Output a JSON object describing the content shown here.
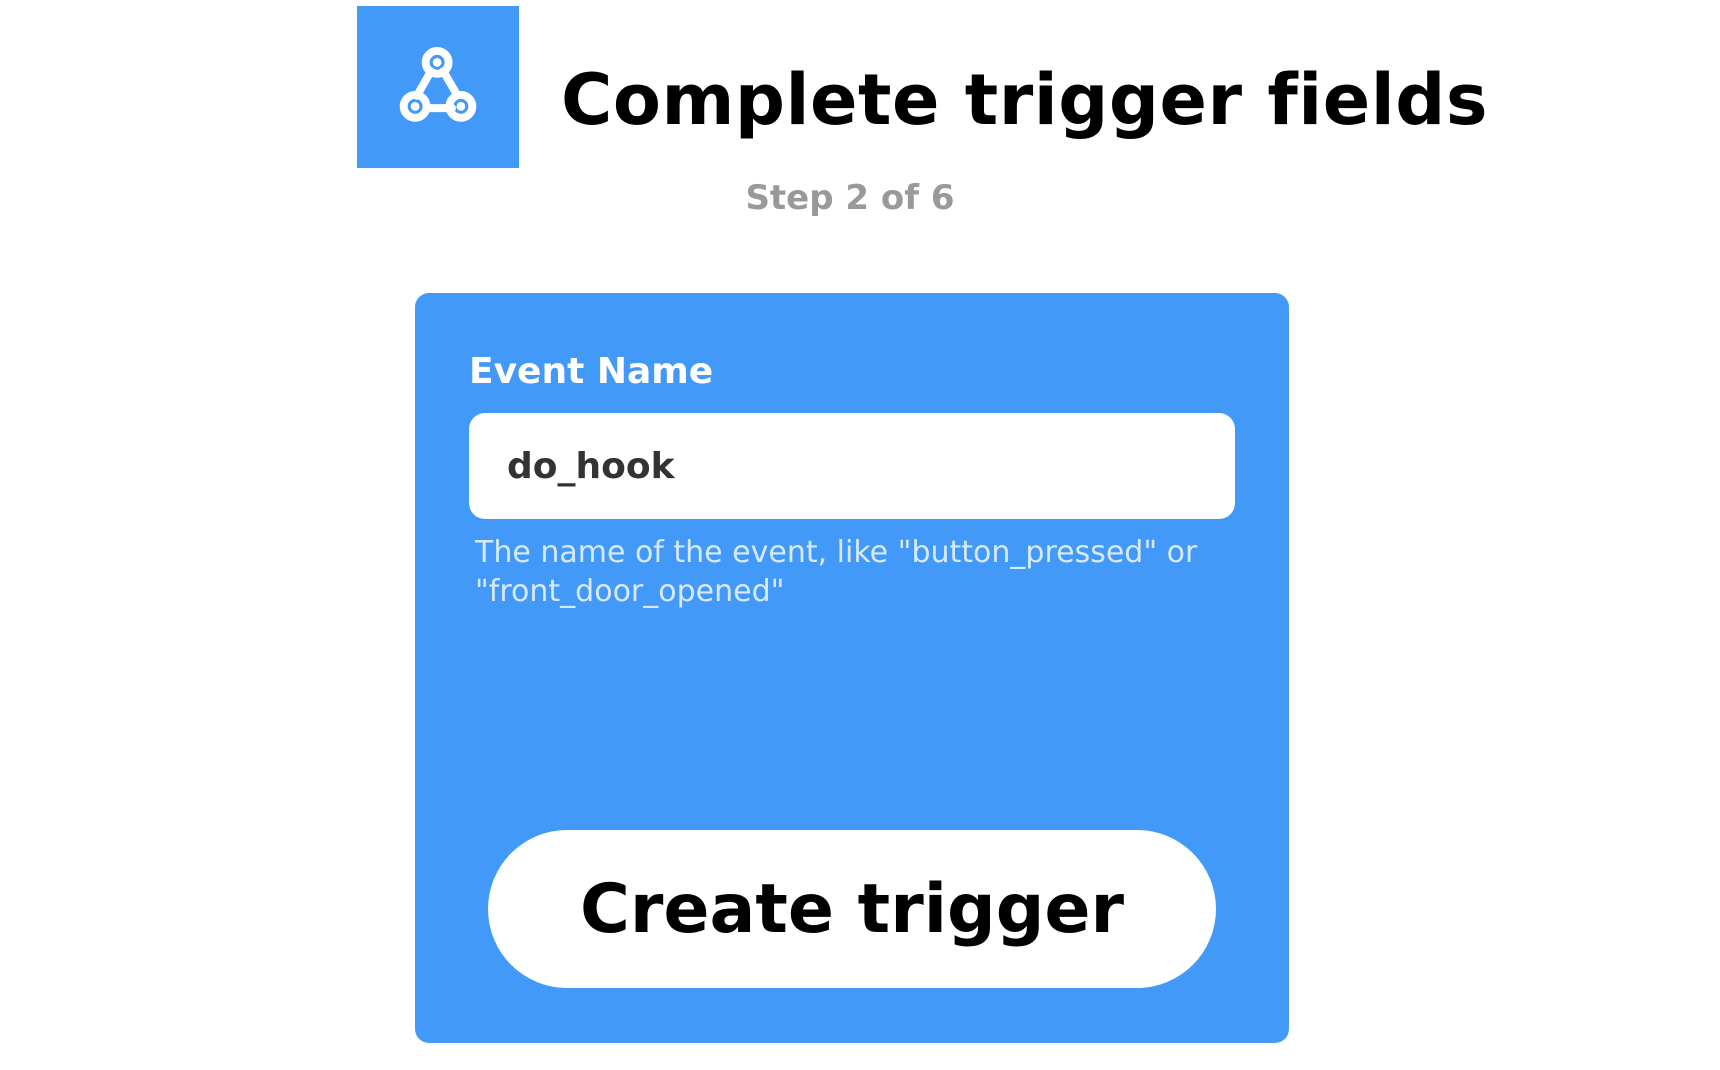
{
  "header": {
    "service_icon": "webhooks-icon",
    "title": "Complete trigger fields",
    "step": "Step 2 of 6"
  },
  "form": {
    "field_label": "Event Name",
    "field_value": "do_hook",
    "help_text": "The name of the event, like \"button_pressed\" or \"front_door_opened\"",
    "submit_label": "Create trigger"
  },
  "colors": {
    "accent": "#4299f7",
    "step_text": "#999999",
    "help_text": "#d6e9fd"
  }
}
